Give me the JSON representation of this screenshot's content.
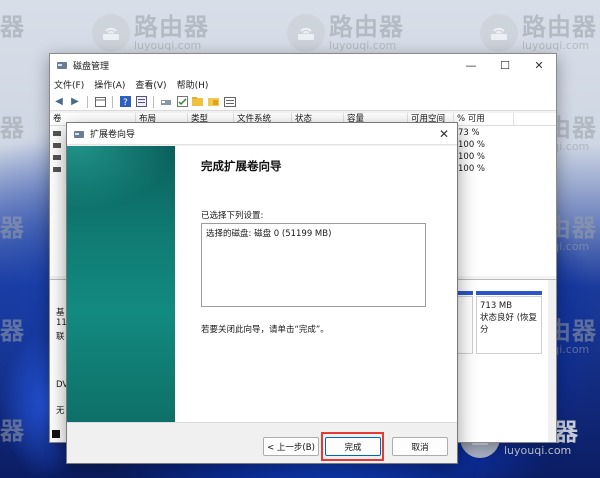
{
  "watermark": {
    "name": "路由器",
    "domain": "luyouqi.com",
    "left_fragment": "器"
  },
  "main_window": {
    "title": "磁盘管理",
    "controls": {
      "minimize": "—",
      "maximize": "☐",
      "close": "✕"
    },
    "menu": [
      "文件(F)",
      "操作(A)",
      "查看(V)",
      "帮助(H)"
    ],
    "columns": [
      "卷",
      "布局",
      "类型",
      "文件系统",
      "状态",
      "容量",
      "可用空间",
      "% 可用"
    ],
    "volume_rows": [
      {
        "pct": "73 %"
      },
      {
        "pct": "100 %"
      },
      {
        "pct": "100 %"
      },
      {
        "pct": "100 %"
      }
    ],
    "lower": {
      "disk_lines": [
        "基",
        "11",
        "联"
      ],
      "dvd_label": "DV",
      "none_label": "无",
      "partition": {
        "size": "713 MB",
        "status": "状态良好 (恢复分"
      }
    }
  },
  "wizard": {
    "title": "扩展卷向导",
    "close": "✕",
    "heading": "完成扩展卷向导",
    "selected_label": "已选择下列设置:",
    "selected_value": "选择的磁盘: 磁盘 0 (51199 MB)",
    "note": "若要关闭此向导，请单击“完成”。",
    "buttons": {
      "back": "< 上一步(B)",
      "finish": "完成",
      "cancel": "取消"
    }
  },
  "colors": {
    "accent": "#0067c0",
    "highlight": "#e53935",
    "sidebar": "#0f7a72"
  }
}
